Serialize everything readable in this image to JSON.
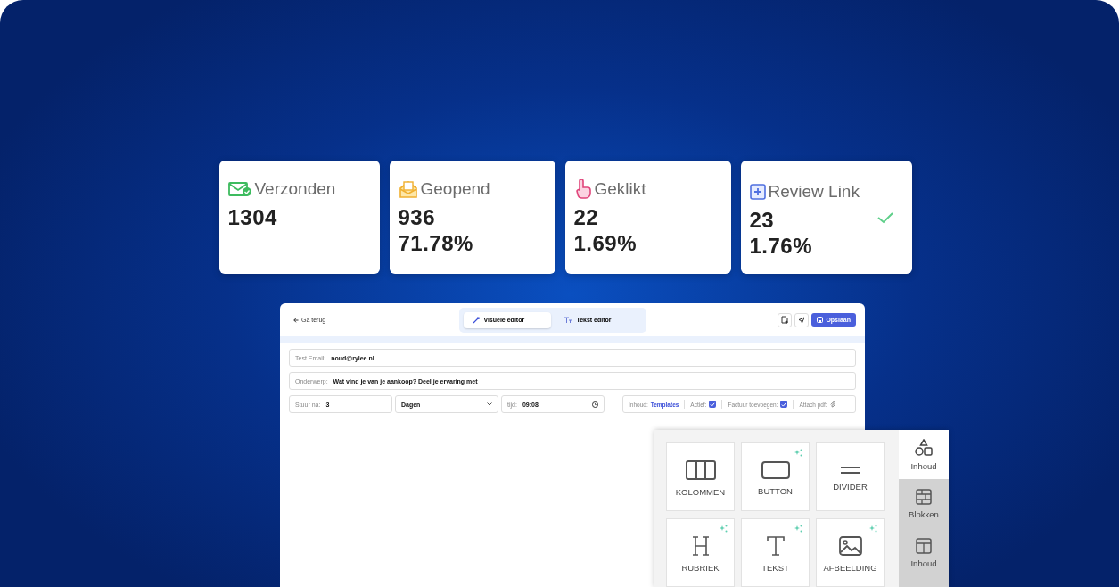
{
  "stats": [
    {
      "kind": "sent",
      "label": "Verzonden",
      "count": "1304",
      "verified": false
    },
    {
      "kind": "opened",
      "label": "Geopend",
      "count": "936",
      "percent": "71.78%",
      "verified": false
    },
    {
      "kind": "clicked",
      "label": "Geklikt",
      "count": "22",
      "percent": "1.69%",
      "verified": false
    },
    {
      "kind": "review",
      "label": "Review Link",
      "count": "23",
      "percent": "1.76%",
      "verified": true
    }
  ],
  "editor": {
    "back": "Ga terug",
    "tabs": [
      {
        "kind": "visual",
        "label": "Visuele editor",
        "selected": true
      },
      {
        "kind": "text",
        "label": "Tekst editor",
        "selected": false
      }
    ],
    "save": "Opslaan",
    "fields": [
      {
        "label": "Test Email:",
        "value": "noud@rylee.nl"
      },
      {
        "label": "Onderwerp:",
        "value": "Wat vind je van je aankoop? Deel je ervaring met"
      }
    ],
    "send_after": {
      "label": "Stuur na:",
      "value": "3"
    },
    "unit": "Dagen",
    "time": {
      "label": "tijd:",
      "value": "09:08"
    },
    "content": {
      "label": "Inhoud:",
      "link": "Templates"
    },
    "checkboxes": [
      {
        "label": "Actief:",
        "checked": true
      },
      {
        "label": "Factuur toevoegen:",
        "checked": true
      }
    ],
    "attach": "Attach pdf:"
  },
  "blocks": {
    "tiles": [
      {
        "kind": "columns",
        "label": "KOLOMMEN",
        "sparkle": false
      },
      {
        "kind": "button",
        "label": "BUTTON",
        "sparkle": true
      },
      {
        "kind": "divider",
        "label": "DIVIDER",
        "sparkle": false
      },
      {
        "kind": "heading",
        "label": "RUBRIEK",
        "sparkle": true
      },
      {
        "kind": "text",
        "label": "TEKST",
        "sparkle": true
      },
      {
        "kind": "image",
        "label": "AFBEELDING",
        "sparkle": true
      }
    ],
    "tabs": [
      {
        "kind": "shapes",
        "label": "Inhoud",
        "selected": true
      },
      {
        "kind": "bricks",
        "label": "Blokken",
        "selected": false
      },
      {
        "kind": "layout",
        "label": "Inhoud",
        "selected": false
      }
    ]
  }
}
